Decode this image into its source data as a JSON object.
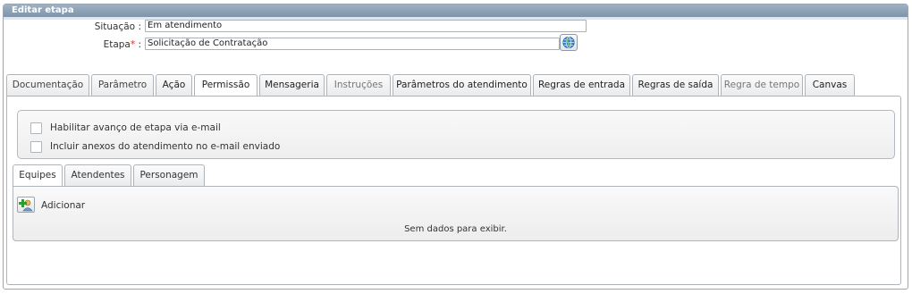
{
  "panel": {
    "title": "Editar etapa"
  },
  "form": {
    "situacao_label": "Situação",
    "situacao_value": "Em atendimento",
    "etapa_label": "Etapa",
    "required_mark": "*",
    "etapa_value": "Solicitação de Contratação",
    "colon": ":"
  },
  "tabs": [
    {
      "label": "Documentação"
    },
    {
      "label": "Parâmetro"
    },
    {
      "label": "Ação"
    },
    {
      "label": "Permissão"
    },
    {
      "label": "Mensageria"
    },
    {
      "label": "Instruções"
    },
    {
      "label": "Parâmetros do atendimento"
    },
    {
      "label": "Regras de entrada"
    },
    {
      "label": "Regras de saída"
    },
    {
      "label": "Regra de tempo"
    },
    {
      "label": "Canvas"
    }
  ],
  "options": {
    "email_advance_label": "Habilitar avanço de etapa via e-mail",
    "attach_label": "Incluir anexos do atendimento no e-mail enviado"
  },
  "subtabs": [
    {
      "label": "Equipes"
    },
    {
      "label": "Atendentes"
    },
    {
      "label": "Personagem"
    }
  ],
  "grid": {
    "add_label": "Adicionar",
    "empty_text": "Sem dados para exibir."
  },
  "icons": {
    "globe": "globe-icon",
    "add": "add-person-icon"
  },
  "colors": {
    "header_bg": "#8ea2b6",
    "required": "#d0342c"
  }
}
